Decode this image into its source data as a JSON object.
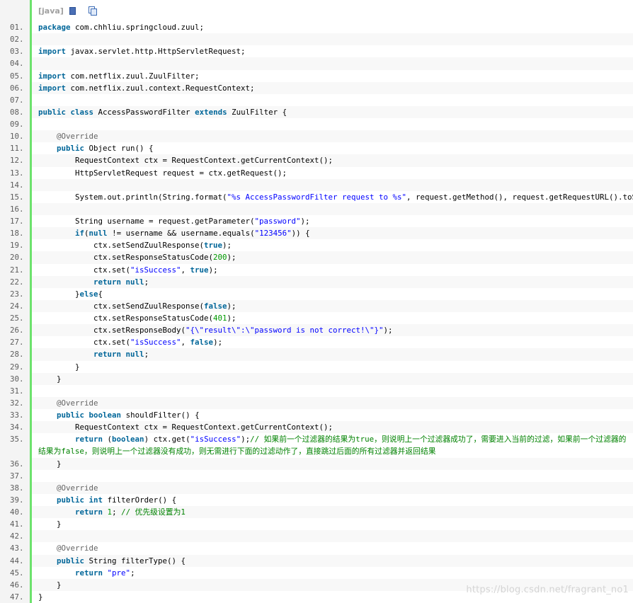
{
  "toolbar": {
    "language_label": "[java]",
    "view_icon": "view-source-icon",
    "copy_icon": "copy-icon"
  },
  "colors": {
    "keyword": "#006699",
    "string": "#0000ff",
    "number": "#009900",
    "annotation": "#646464",
    "comment": "#008200",
    "gutter_border": "#6ce26c",
    "gutter_background": "#f4f4f4",
    "line_number": "#5c5c5c",
    "alt_row": "#f8f8f8"
  },
  "lines": [
    {
      "num": "01.",
      "tokens": [
        [
          "kw",
          "package"
        ],
        [
          "tx",
          " com.chhliu.springcloud.zuul;"
        ]
      ]
    },
    {
      "num": "02.",
      "tokens": []
    },
    {
      "num": "03.",
      "tokens": [
        [
          "kw",
          "import"
        ],
        [
          "tx",
          " javax.servlet.http.HttpServletRequest;"
        ]
      ]
    },
    {
      "num": "04.",
      "tokens": []
    },
    {
      "num": "05.",
      "tokens": [
        [
          "kw",
          "import"
        ],
        [
          "tx",
          " com.netflix.zuul.ZuulFilter;"
        ]
      ]
    },
    {
      "num": "06.",
      "tokens": [
        [
          "kw",
          "import"
        ],
        [
          "tx",
          " com.netflix.zuul.context.RequestContext;"
        ]
      ]
    },
    {
      "num": "07.",
      "tokens": []
    },
    {
      "num": "08.",
      "tokens": [
        [
          "kw",
          "public"
        ],
        [
          "tx",
          " "
        ],
        [
          "kw",
          "class"
        ],
        [
          "tx",
          " AccessPasswordFilter "
        ],
        [
          "kw",
          "extends"
        ],
        [
          "tx",
          " ZuulFilter {"
        ]
      ]
    },
    {
      "num": "09.",
      "tokens": []
    },
    {
      "num": "10.",
      "tokens": [
        [
          "tx",
          "    "
        ],
        [
          "ann",
          "@Override"
        ]
      ]
    },
    {
      "num": "11.",
      "tokens": [
        [
          "tx",
          "    "
        ],
        [
          "kw",
          "public"
        ],
        [
          "tx",
          " Object run() {"
        ]
      ]
    },
    {
      "num": "12.",
      "tokens": [
        [
          "tx",
          "        RequestContext ctx = RequestContext.getCurrentContext();"
        ]
      ]
    },
    {
      "num": "13.",
      "tokens": [
        [
          "tx",
          "        HttpServletRequest request = ctx.getRequest();"
        ]
      ]
    },
    {
      "num": "14.",
      "tokens": []
    },
    {
      "num": "15.",
      "tokens": [
        [
          "tx",
          "        System.out.println(String.format("
        ],
        [
          "str",
          "\"%s AccessPasswordFilter request to %s\""
        ],
        [
          "tx",
          ", request.getMethod(), request.getRequestURL().toStri"
        ]
      ]
    },
    {
      "num": "16.",
      "tokens": []
    },
    {
      "num": "17.",
      "tokens": [
        [
          "tx",
          "        String username = request.getParameter("
        ],
        [
          "str",
          "\"password\""
        ],
        [
          "tx",
          ");"
        ]
      ]
    },
    {
      "num": "18.",
      "tokens": [
        [
          "tx",
          "        "
        ],
        [
          "kw",
          "if"
        ],
        [
          "tx",
          "("
        ],
        [
          "kw",
          "null"
        ],
        [
          "tx",
          " != username && username.equals("
        ],
        [
          "str",
          "\"123456\""
        ],
        [
          "tx",
          ")) {"
        ]
      ]
    },
    {
      "num": "19.",
      "tokens": [
        [
          "tx",
          "            ctx.setSendZuulResponse("
        ],
        [
          "kw",
          "true"
        ],
        [
          "tx",
          ");"
        ]
      ]
    },
    {
      "num": "20.",
      "tokens": [
        [
          "tx",
          "            ctx.setResponseStatusCode("
        ],
        [
          "num",
          "200"
        ],
        [
          "tx",
          ");"
        ]
      ]
    },
    {
      "num": "21.",
      "tokens": [
        [
          "tx",
          "            ctx.set("
        ],
        [
          "str",
          "\"isSuccess\""
        ],
        [
          "tx",
          ", "
        ],
        [
          "kw",
          "true"
        ],
        [
          "tx",
          ");"
        ]
      ]
    },
    {
      "num": "22.",
      "tokens": [
        [
          "tx",
          "            "
        ],
        [
          "kw",
          "return"
        ],
        [
          "tx",
          " "
        ],
        [
          "kw",
          "null"
        ],
        [
          "tx",
          ";"
        ]
      ]
    },
    {
      "num": "23.",
      "tokens": [
        [
          "tx",
          "        }"
        ],
        [
          "kw",
          "else"
        ],
        [
          "tx",
          "{"
        ]
      ]
    },
    {
      "num": "24.",
      "tokens": [
        [
          "tx",
          "            ctx.setSendZuulResponse("
        ],
        [
          "kw",
          "false"
        ],
        [
          "tx",
          ");"
        ]
      ]
    },
    {
      "num": "25.",
      "tokens": [
        [
          "tx",
          "            ctx.setResponseStatusCode("
        ],
        [
          "num",
          "401"
        ],
        [
          "tx",
          ");"
        ]
      ]
    },
    {
      "num": "26.",
      "tokens": [
        [
          "tx",
          "            ctx.setResponseBody("
        ],
        [
          "str",
          "\"{\\\"result\\\":\\\"password is not correct!\\\"}\""
        ],
        [
          "tx",
          ");"
        ]
      ]
    },
    {
      "num": "27.",
      "tokens": [
        [
          "tx",
          "            ctx.set("
        ],
        [
          "str",
          "\"isSuccess\""
        ],
        [
          "tx",
          ", "
        ],
        [
          "kw",
          "false"
        ],
        [
          "tx",
          ");"
        ]
      ]
    },
    {
      "num": "28.",
      "tokens": [
        [
          "tx",
          "            "
        ],
        [
          "kw",
          "return"
        ],
        [
          "tx",
          " "
        ],
        [
          "kw",
          "null"
        ],
        [
          "tx",
          ";"
        ]
      ]
    },
    {
      "num": "29.",
      "tokens": [
        [
          "tx",
          "        }"
        ]
      ]
    },
    {
      "num": "30.",
      "tokens": [
        [
          "tx",
          "    }"
        ]
      ]
    },
    {
      "num": "31.",
      "tokens": []
    },
    {
      "num": "32.",
      "tokens": [
        [
          "tx",
          "    "
        ],
        [
          "ann",
          "@Override"
        ]
      ]
    },
    {
      "num": "33.",
      "tokens": [
        [
          "tx",
          "    "
        ],
        [
          "kw",
          "public"
        ],
        [
          "tx",
          " "
        ],
        [
          "kw",
          "boolean"
        ],
        [
          "tx",
          " shouldFilter() {"
        ]
      ]
    },
    {
      "num": "34.",
      "tokens": [
        [
          "tx",
          "        RequestContext ctx = RequestContext.getCurrentContext();"
        ]
      ]
    },
    {
      "num": "35.",
      "wrap": true,
      "tokens": [
        [
          "tx",
          "        "
        ],
        [
          "kw",
          "return"
        ],
        [
          "tx",
          " ("
        ],
        [
          "kw",
          "boolean"
        ],
        [
          "tx",
          ") ctx.get("
        ],
        [
          "str",
          "\"isSuccess\""
        ],
        [
          "tx",
          ");"
        ],
        [
          "cmt",
          "// 如果前一个过滤器的结果为true，则说明上一个过滤器成功了，需要进入当前的过滤，如果前一个过滤器的结果为false，则说明上一个过滤器没有成功，则无需进行下面的过滤动作了，直接跳过后面的所有过滤器并返回结果"
        ]
      ]
    },
    {
      "num": "36.",
      "tokens": [
        [
          "tx",
          "    }"
        ]
      ]
    },
    {
      "num": "37.",
      "tokens": []
    },
    {
      "num": "38.",
      "tokens": [
        [
          "tx",
          "    "
        ],
        [
          "ann",
          "@Override"
        ]
      ]
    },
    {
      "num": "39.",
      "tokens": [
        [
          "tx",
          "    "
        ],
        [
          "kw",
          "public"
        ],
        [
          "tx",
          " "
        ],
        [
          "kw",
          "int"
        ],
        [
          "tx",
          " filterOrder() {"
        ]
      ]
    },
    {
      "num": "40.",
      "tokens": [
        [
          "tx",
          "        "
        ],
        [
          "kw",
          "return"
        ],
        [
          "tx",
          " "
        ],
        [
          "num",
          "1"
        ],
        [
          "tx",
          "; "
        ],
        [
          "cmt",
          "// 优先级设置为1"
        ]
      ]
    },
    {
      "num": "41.",
      "tokens": [
        [
          "tx",
          "    }"
        ]
      ]
    },
    {
      "num": "42.",
      "tokens": []
    },
    {
      "num": "43.",
      "tokens": [
        [
          "tx",
          "    "
        ],
        [
          "ann",
          "@Override"
        ]
      ]
    },
    {
      "num": "44.",
      "tokens": [
        [
          "tx",
          "    "
        ],
        [
          "kw",
          "public"
        ],
        [
          "tx",
          " String filterType() {"
        ]
      ]
    },
    {
      "num": "45.",
      "tokens": [
        [
          "tx",
          "        "
        ],
        [
          "kw",
          "return"
        ],
        [
          "tx",
          " "
        ],
        [
          "str",
          "\"pre\""
        ],
        [
          "tx",
          ";"
        ]
      ]
    },
    {
      "num": "46.",
      "tokens": [
        [
          "tx",
          "    }"
        ]
      ]
    },
    {
      "num": "47.",
      "tokens": [
        [
          "tx",
          "}"
        ]
      ]
    }
  ],
  "watermark": "https://blog.csdn.net/fragrant_no1"
}
